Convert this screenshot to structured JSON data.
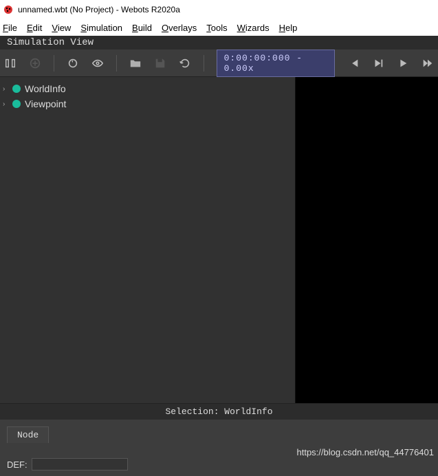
{
  "window": {
    "title": "unnamed.wbt (No Project) - Webots R2020a"
  },
  "menu": {
    "file": "File",
    "edit": "Edit",
    "view": "View",
    "simulation": "Simulation",
    "build": "Build",
    "overlays": "Overlays",
    "tools": "Tools",
    "wizards": "Wizards",
    "help": "Help"
  },
  "sim_header": "Simulation View",
  "time_display": "0:00:00:000 - 0.00x",
  "tree": [
    {
      "label": "WorldInfo"
    },
    {
      "label": "Viewpoint"
    }
  ],
  "selection_label": "Selection: WorldInfo",
  "node_tab": "Node",
  "def_label": "DEF:",
  "def_value": "",
  "watermark": "https://blog.csdn.net/qq_44776401"
}
